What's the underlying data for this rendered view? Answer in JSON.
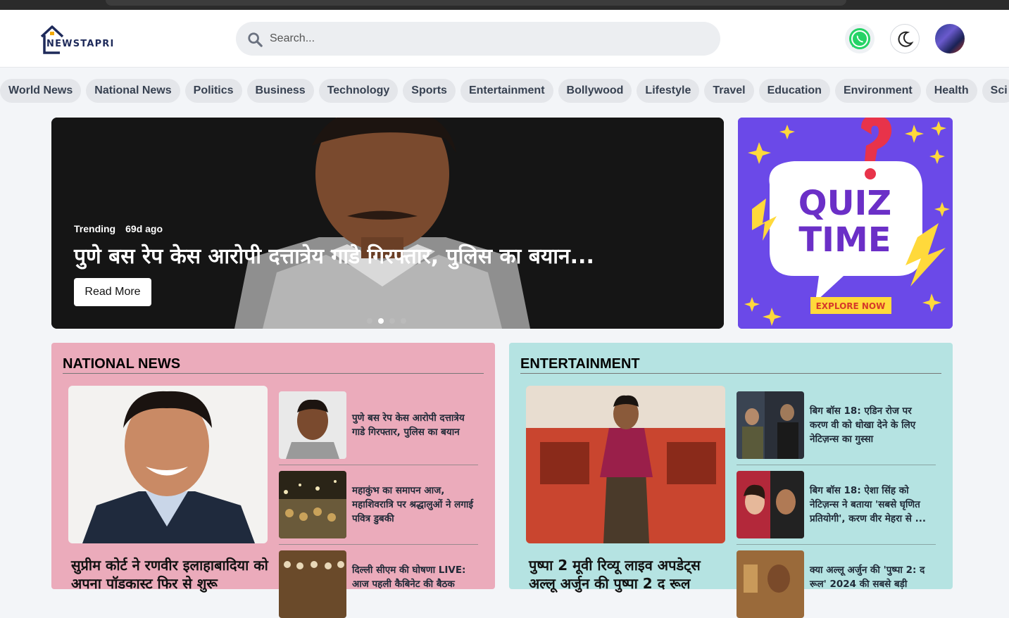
{
  "site": {
    "logo_text": "NEWSTAPRI"
  },
  "search": {
    "placeholder": "Search..."
  },
  "header_icons": [
    "whatsapp-icon",
    "moon-icon",
    "avatar"
  ],
  "categories": [
    "World News",
    "National News",
    "Politics",
    "Business",
    "Technology",
    "Sports",
    "Entertainment",
    "Bollywood",
    "Lifestyle",
    "Travel",
    "Education",
    "Environment",
    "Health",
    "Sci"
  ],
  "hero": {
    "badge": "Trending",
    "time": "69d ago",
    "title": "पुणे बस रेप केस आरोपी दत्तात्रेय गाडे गिरफ्तार, पुलिस का बयान...",
    "button": "Read More",
    "slides": 4,
    "active_slide": 2
  },
  "ad": {
    "line1": "QUIZ",
    "line2": "TIME",
    "cta": "EXPLORE NOW"
  },
  "national": {
    "heading": "NATIONAL NEWS",
    "main_title": "सुप्रीम कोर्ट ने रणवीर इलाहाबादिया को अपना पॉडकास्ट फिर से शुरू",
    "items": [
      "पुणे बस रेप केस आरोपी दत्तात्रेय गाडे गिरफ्तार, पुलिस का बयान",
      "महाकुंभ का समापन आज, महाशिवरात्रि पर श्रद्धालुओं ने लगाई पवित्र डुबकी",
      "दिल्ली सीएम की घोषणा LIVE: आज पहली कैबिनेट की बैठक"
    ]
  },
  "entertainment": {
    "heading": "ENTERTAINMENT",
    "main_title": "पुष्पा 2 मूवी रिव्यू लाइव अपडेट्स अल्लू अर्जुन की पुष्पा 2 द रूल",
    "items": [
      "बिग बॉस 18: एडिन रोज पर करण वी को धोखा देने के लिए नेटिज़न्स का गुस्सा",
      "बिग बॉस 18: ऐशा सिंह को नेटिज़न्स ने बताया 'सबसे घृणित प्रतियोगी', करण वीर मेहरा से ...",
      "क्या अल्लू अर्जुन की 'पुष्पा 2: द रूल' 2024 की सबसे बड़ी"
    ]
  },
  "colors": {
    "national_bg": "#ebabbb",
    "entertainment_bg": "#b5e3e2",
    "quiz_bg": "#6b49e8"
  }
}
